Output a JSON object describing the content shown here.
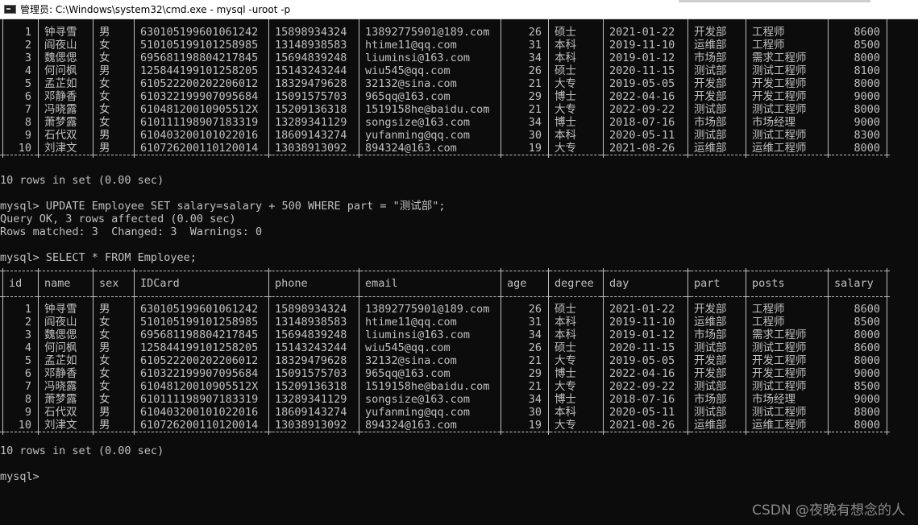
{
  "window": {
    "title": "管理员: C:\\Windows\\system32\\cmd.exe - mysql  -uroot -p"
  },
  "columns": [
    "id",
    "name",
    "sex",
    "IDCard",
    "phone",
    "email",
    "age",
    "degree",
    "day",
    "part",
    "posts",
    "salary"
  ],
  "rows_before": [
    [
      "1",
      "钟寻雪",
      "男",
      "630105199601061242",
      "15898934324",
      "13892775901@189.com",
      "26",
      "硕士",
      "2021-01-22",
      "开发部",
      "工程师",
      "8600"
    ],
    [
      "2",
      "阎夜山",
      "女",
      "510105199101258985",
      "13148938583",
      "htime11@qq.com",
      "31",
      "本科",
      "2019-11-10",
      "运维部",
      "工程师",
      "8500"
    ],
    [
      "3",
      "魏偲偲",
      "女",
      "695681198804217845",
      "15694839248",
      "liuminsi@163.com",
      "34",
      "本科",
      "2019-01-12",
      "市场部",
      "需求工程师",
      "8000"
    ],
    [
      "4",
      "何问枫",
      "男",
      "125844199101258205",
      "15143243244",
      "wiu545@qq.com",
      "26",
      "硕士",
      "2020-11-15",
      "测试部",
      "测试工程师",
      "8100"
    ],
    [
      "5",
      "孟芷如",
      "女",
      "610522200202206012",
      "18329479628",
      "32132@sina.com",
      "21",
      "大专",
      "2019-05-05",
      "开发部",
      "开发工程师",
      "8000"
    ],
    [
      "6",
      "邓静香",
      "女",
      "610322199907095684",
      "15091575703",
      "965qq@163.com",
      "29",
      "博士",
      "2022-04-16",
      "开发部",
      "开发工程师",
      "9000"
    ],
    [
      "7",
      "冯晓露",
      "女",
      "61048120010905512X",
      "15209136318",
      "1519158he@baidu.com",
      "21",
      "大专",
      "2022-09-22",
      "测试部",
      "测试工程师",
      "8000"
    ],
    [
      "8",
      "萧梦露",
      "女",
      "610111198907183319",
      "13289341129",
      "songsize@163.com",
      "34",
      "博士",
      "2018-07-16",
      "市场部",
      "市场经理",
      "9000"
    ],
    [
      "9",
      "石代双",
      "男",
      "610403200101022016",
      "18609143274",
      "yufanming@qq.com",
      "30",
      "本科",
      "2020-05-11",
      "测试部",
      "测试工程师",
      "8300"
    ],
    [
      "10",
      "刘津文",
      "男",
      "610726200110120014",
      "13038913092",
      "894324@163.com",
      "19",
      "大专",
      "2021-08-26",
      "运维部",
      "运维工程师",
      "8000"
    ]
  ],
  "rows_after": [
    [
      "1",
      "钟寻雪",
      "男",
      "630105199601061242",
      "15898934324",
      "13892775901@189.com",
      "26",
      "硕士",
      "2021-01-22",
      "开发部",
      "工程师",
      "8600"
    ],
    [
      "2",
      "阎夜山",
      "女",
      "510105199101258985",
      "13148938583",
      "htime11@qq.com",
      "31",
      "本科",
      "2019-11-10",
      "运维部",
      "工程师",
      "8500"
    ],
    [
      "3",
      "魏偲偲",
      "女",
      "695681198804217845",
      "15694839248",
      "liuminsi@163.com",
      "34",
      "本科",
      "2019-01-12",
      "市场部",
      "需求工程师",
      "8000"
    ],
    [
      "4",
      "何问枫",
      "男",
      "125844199101258205",
      "15143243244",
      "wiu545@qq.com",
      "26",
      "硕士",
      "2020-11-15",
      "测试部",
      "测试工程师",
      "8600"
    ],
    [
      "5",
      "孟芷如",
      "女",
      "610522200202206012",
      "18329479628",
      "32132@sina.com",
      "21",
      "大专",
      "2019-05-05",
      "开发部",
      "开发工程师",
      "8000"
    ],
    [
      "6",
      "邓静香",
      "女",
      "610322199907095684",
      "15091575703",
      "965qq@163.com",
      "29",
      "博士",
      "2022-04-16",
      "开发部",
      "开发工程师",
      "9000"
    ],
    [
      "7",
      "冯晓露",
      "女",
      "61048120010905512X",
      "15209136318",
      "1519158he@baidu.com",
      "21",
      "大专",
      "2022-09-22",
      "测试部",
      "测试工程师",
      "8500"
    ],
    [
      "8",
      "萧梦露",
      "女",
      "610111198907183319",
      "13289341129",
      "songsize@163.com",
      "34",
      "博士",
      "2018-07-16",
      "市场部",
      "市场经理",
      "9000"
    ],
    [
      "9",
      "石代双",
      "男",
      "610403200101022016",
      "18609143274",
      "yufanming@qq.com",
      "30",
      "本科",
      "2020-05-11",
      "测试部",
      "测试工程师",
      "8800"
    ],
    [
      "10",
      "刘津文",
      "男",
      "610726200110120014",
      "13038913092",
      "894324@163.com",
      "19",
      "大专",
      "2021-08-26",
      "运维部",
      "运维工程师",
      "8000"
    ]
  ],
  "console": {
    "rows_in_set_1": "10 rows in set (0.00 sec)",
    "cmd_update": "mysql> UPDATE Employee SET salary=salary + 500 WHERE part = \"测试部\";",
    "query_ok": "Query OK, 3 rows affected (0.00 sec)",
    "rows_matched": "Rows matched: 3  Changed: 3  Warnings: 0",
    "cmd_select": "mysql> SELECT * FROM Employee;",
    "rows_in_set_2": "10 rows in set (0.00 sec)",
    "prompt": "mysql>"
  },
  "watermark": "CSDN @夜晚有想念的人",
  "colors": {
    "background": "#0c0c0c",
    "text": "#c0c0c0",
    "titlebar": "#ffffff"
  }
}
